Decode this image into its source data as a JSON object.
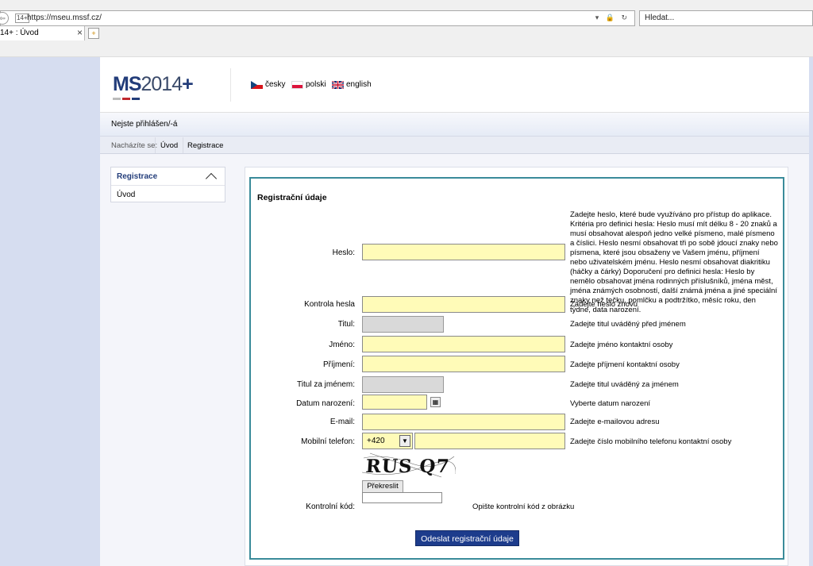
{
  "browser": {
    "url": "https://mseu.mssf.cz/",
    "url_icon": "14+",
    "url_right": "▾ 🔒 ↻",
    "search_placeholder": "Hledat...",
    "tab_label": "14+ : Úvod",
    "tab_close": "×"
  },
  "header": {
    "logo_bold": "MS",
    "logo_light": "2014",
    "logo_plus": "+",
    "languages": [
      {
        "label": "česky",
        "icon": "czech-flag-icon"
      },
      {
        "label": "polski",
        "icon": "polish-flag-icon"
      },
      {
        "label": "english",
        "icon": "uk-flag-icon"
      }
    ]
  },
  "status": {
    "text": "Nejste přihlášen/-á"
  },
  "breadcrumb": {
    "label": "Nacházíte se:",
    "items": [
      "Úvod",
      "Registrace"
    ]
  },
  "sidebar": {
    "title": "Registrace",
    "items": [
      "Úvod"
    ]
  },
  "form": {
    "title": "Registrační údaje",
    "fields": [
      {
        "label": "Heslo:",
        "hint": "Zadejte heslo, které bude využíváno pro přístup do aplikace. Kritéria pro definici hesla: Heslo musí mít délku 8 - 20 znaků a musí obsahovat alespoň jedno velké písmeno, malé písmeno a číslici. Heslo nesmí obsahovat tři po sobě jdoucí znaky nebo písmena, které jsou obsaženy ve Vašem jménu, příjmení nebo uživatelském jménu. Heslo nesmí obsahovat diakritiku (háčky a čárky) Doporučení pro definici hesla: Heslo by nemělo obsahovat jména rodinných příslušníků, jména měst, jména známých osobností, další známá jména a jiné speciální znaky než tečku, pomlčku a podtržítko, měsíc roku, den týdne, data narození."
      },
      {
        "label": "Kontrola hesla",
        "hint": "Zadejte heslo znovu"
      },
      {
        "label": "Titul:",
        "hint": "Zadejte titul uváděný před jménem"
      },
      {
        "label": "Jméno:",
        "hint": "Zadejte jméno kontaktní osoby"
      },
      {
        "label": "Příjmení:",
        "hint": "Zadejte příjmení kontaktní osoby"
      },
      {
        "label": "Titul za jménem:",
        "hint": "Zadejte titul uváděný za jménem"
      },
      {
        "label": "Datum narození:",
        "hint": "Vyberte datum narození"
      },
      {
        "label": "E-mail:",
        "hint": "Zadejte e-mailovou adresu"
      },
      {
        "label": "Mobilní telefon:",
        "hint": "Zadejte číslo mobilního telefonu kontaktní osoby"
      },
      {
        "label": "Kontrolní kód:",
        "hint": "Opište kontrolní kód z obrázku"
      }
    ],
    "phone_prefix": "+420",
    "captcha_text": "RUS Q7",
    "redraw_label": "Překreslit",
    "submit_label": "Odeslat registrační údaje"
  },
  "colors": {
    "accent": "#1d3c8c",
    "panel_border": "#3a8b9a",
    "input_bg": "#fffbb8"
  }
}
